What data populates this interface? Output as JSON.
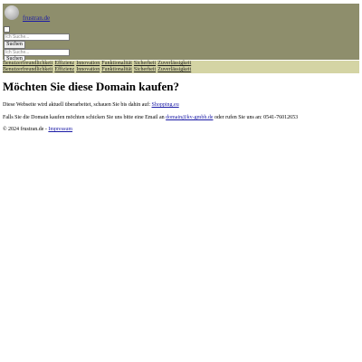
{
  "header": {
    "logo_text": "frustran.de",
    "search_placeholder": "Ich Suche...",
    "search_button_label": "Suchen"
  },
  "nav": {
    "items": [
      "Benutzerfreundlichkeit",
      "Effizienz",
      "Innovation",
      "Funktionalität",
      "Sicherheit",
      "Zuverlässigkeit"
    ]
  },
  "main": {
    "title": "Möchten Sie diese Domain kaufen?",
    "info_text": "Diese Webseite wird aktuell überarbeitet, schauen Sie bis dahin auf:",
    "info_link": "Shopping.eu",
    "contact_text_before": "Falls Sie die Domain kaufen möchten schicken Sie uns bitte eine Email an",
    "contact_email": "domain@kv-gmbh.de",
    "contact_text_after": "oder rufen Sie uns an: 0541-76012653"
  },
  "footer": {
    "copyright": "© 2024 frustran.de -",
    "impressum_label": "Impressum"
  },
  "colors": {
    "header_bg": "#8e8e6c",
    "nav_bg": "#d4d4a4",
    "link": "#1a1aa6"
  }
}
